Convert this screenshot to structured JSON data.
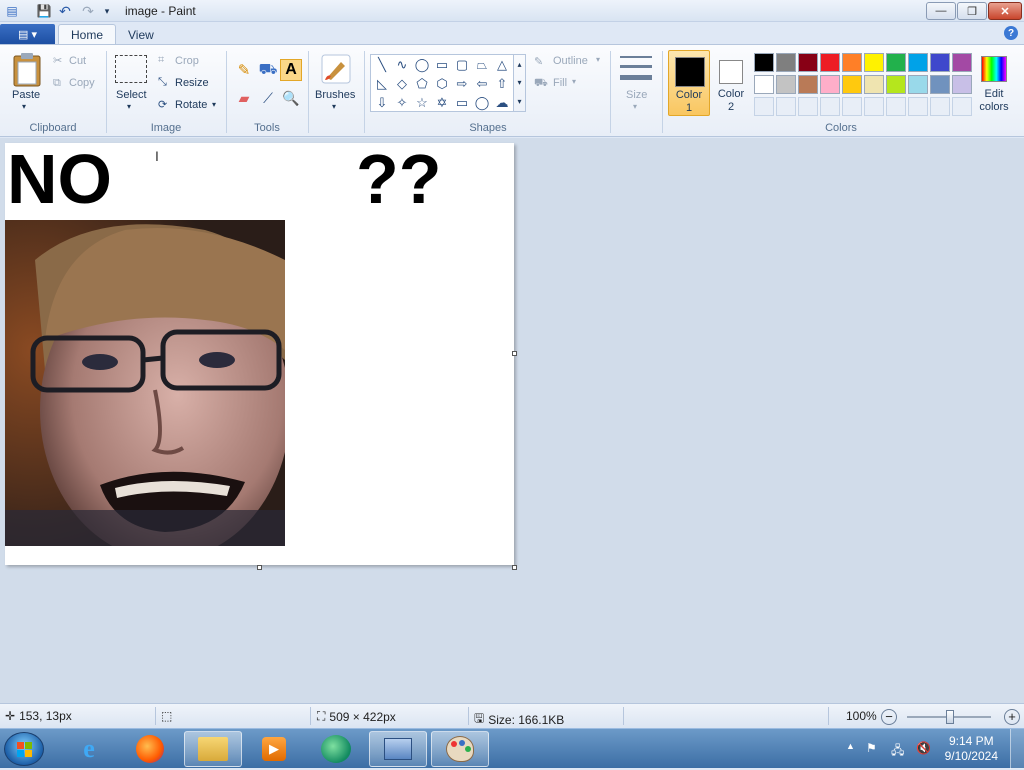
{
  "window": {
    "title": "image - Paint",
    "controls": {
      "minimize": "—",
      "maximize": "❐",
      "close": "✕"
    }
  },
  "ribbon": {
    "file_icon": "▤ ▾",
    "tabs": [
      {
        "label": "Home"
      },
      {
        "label": "View"
      }
    ],
    "help": "?",
    "clipboard": {
      "group": "Clipboard",
      "paste": "Paste",
      "cut": "Cut",
      "copy": "Copy"
    },
    "image": {
      "group": "Image",
      "select": "Select",
      "crop": "Crop",
      "resize": "Resize",
      "rotate": "Rotate"
    },
    "tools": {
      "group": "Tools"
    },
    "brushes": {
      "label": "Brushes"
    },
    "shapes": {
      "group": "Shapes",
      "outline": "Outline",
      "fill": "Fill"
    },
    "size": {
      "label": "Size"
    },
    "colors": {
      "group": "Colors",
      "color1": "Color\n1",
      "color1_line1": "Color",
      "color1_line2": "1",
      "color2_line1": "Color",
      "color2_line2": "2",
      "edit_line1": "Edit",
      "edit_line2": "colors",
      "color1_value": "#000000",
      "color2_value": "#ffffff",
      "palette_row1": [
        "#000000",
        "#7f7f7f",
        "#880015",
        "#ed1c24",
        "#ff7f27",
        "#fff200",
        "#22b14c",
        "#00a2e8",
        "#3f48cc",
        "#a349a4"
      ],
      "palette_row2": [
        "#ffffff",
        "#c3c3c3",
        "#b97a57",
        "#ffaec9",
        "#ffc90e",
        "#efe4b0",
        "#b5e61d",
        "#99d9ea",
        "#7092be",
        "#c8bfe7"
      ]
    }
  },
  "canvas": {
    "text_no": "NO",
    "text_qq": "??"
  },
  "status": {
    "cursor_pos": "153, 13px",
    "image_size": "509 × 422px",
    "file_size": "Size: 166.1KB",
    "zoom": "100%"
  },
  "taskbar": {
    "time": "9:14 PM",
    "date": "9/10/2024"
  }
}
